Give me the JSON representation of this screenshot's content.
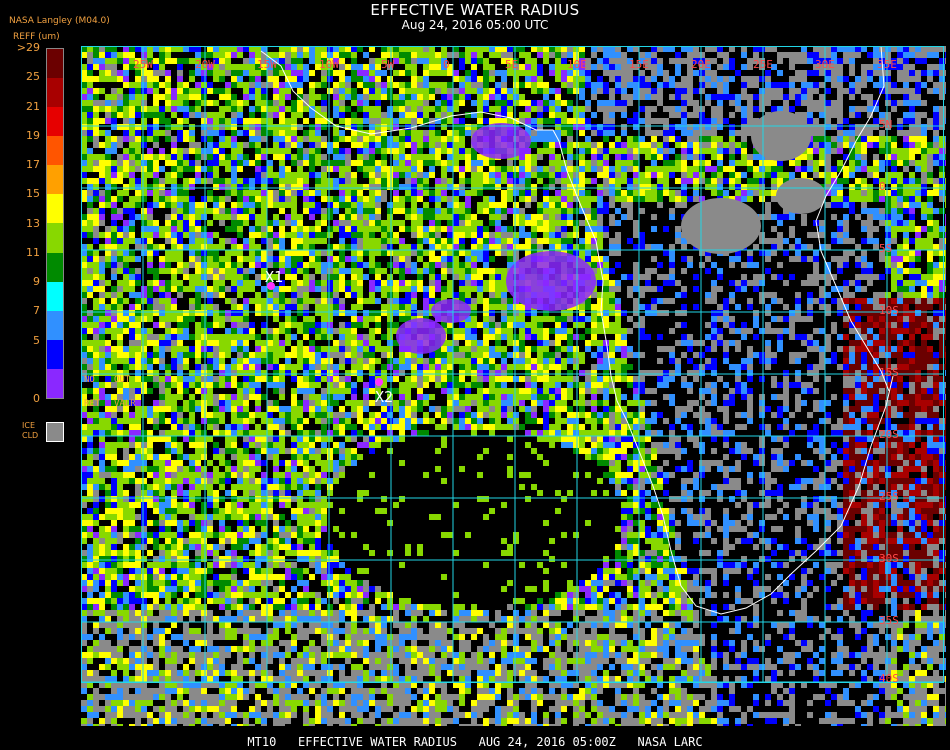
{
  "header": {
    "title": "EFFECTIVE WATER RADIUS",
    "subtitle": "Aug 24, 2016 05:00 UTC",
    "source": "NASA Langley (M04.0)",
    "unit_label": "REFF (um)"
  },
  "colorbar": {
    "ticks": [
      ">29",
      "25",
      "21",
      "19",
      "17",
      "15",
      "13",
      "11",
      "9",
      "7",
      "5",
      "0"
    ],
    "colors": [
      "#6b0000",
      "#a80000",
      "#e60000",
      "#ff5500",
      "#ffa000",
      "#ffff00",
      "#88d800",
      "#008a00",
      "#00ffff",
      "#3090ff",
      "#0000ff",
      "#8a28ff"
    ],
    "ice_label_1": "ICE",
    "ice_label_2": "CLD",
    "ice_color": "#8a8a8a"
  },
  "map_legend": {
    "no_ret_1": "NO",
    "no_ret_2": "RET",
    "out_valr_1": "OUT",
    "out_valr_2": "VALR"
  },
  "grid_labels": {
    "longitude": [
      "25W",
      "20W",
      "15W",
      "10W",
      "5W",
      "0",
      "5E",
      "10E",
      "15E",
      "20E",
      "25E",
      "30E",
      "35E"
    ],
    "latitude": [
      "5N",
      "0",
      "5S",
      "10S",
      "15S",
      "20S",
      "25S",
      "30S",
      "35S",
      "40S"
    ]
  },
  "markers": [
    {
      "label": "X1"
    },
    {
      "label": "X2"
    }
  ],
  "footer": "MT10   EFFECTIVE WATER RADIUS   AUG 24, 2016 05:00Z   NASA LARC"
}
